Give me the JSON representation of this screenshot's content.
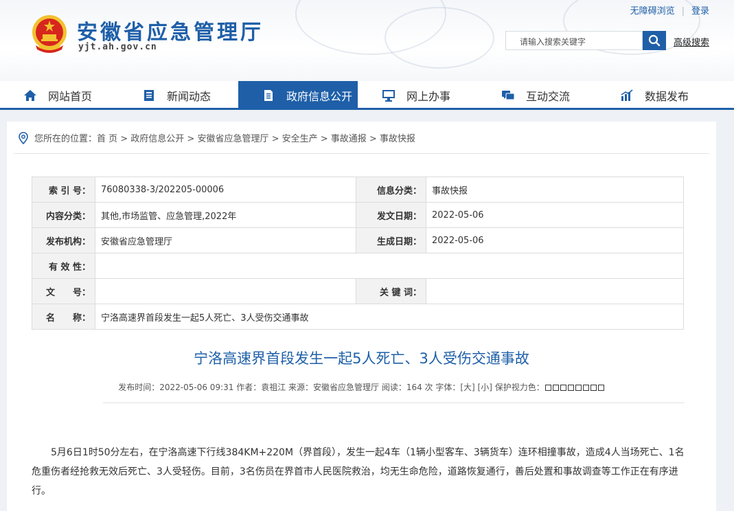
{
  "header": {
    "site_name": "安徽省应急管理厅",
    "domain": "yjt.ah.gov.cn",
    "accessibility_link": "无障碍浏览",
    "login_link": "登录",
    "search_placeholder": "请输入搜索关键字",
    "advanced_search": "高级搜索"
  },
  "nav": {
    "items": [
      {
        "label": "网站首页",
        "icon": "home-icon",
        "active": false
      },
      {
        "label": "新闻动态",
        "icon": "news-icon",
        "active": false
      },
      {
        "label": "政府信息公开",
        "icon": "document-icon",
        "active": true
      },
      {
        "label": "网上办事",
        "icon": "monitor-icon",
        "active": false
      },
      {
        "label": "互动交流",
        "icon": "chat-icon",
        "active": false
      },
      {
        "label": "数据发布",
        "icon": "chart-icon",
        "active": false
      }
    ]
  },
  "breadcrumb": {
    "text": "您所在的位置：首 页 > 政府信息公开 > 安徽省应急管理厅 > 安全生产 > 事故通报 > 事故快报"
  },
  "info": {
    "index_label": "索 引 号：",
    "index_value": "76080338-3/202205-00006",
    "category_label": "信息分类：",
    "category_value": "事故快报",
    "content_label": "内容分类：",
    "content_value": "其他,市场监管、应急管理,2022年",
    "pubdate_label": "发文日期：",
    "pubdate_value": "2022-05-06",
    "org_label": "发布机构：",
    "org_value": "安徽省应急管理厅",
    "gendate_label": "生成日期：",
    "gendate_value": "2022-05-06",
    "validity_label": "有 效 性：",
    "validity_value": "",
    "docno_label": "文　　号：",
    "docno_value": "",
    "keywords_label": "关 键 词：",
    "keywords_value": "",
    "name_label": "名　　称：",
    "name_value": "宁洛高速界首段发生一起5人死亡、3人受伤交通事故"
  },
  "article": {
    "title": "宁洛高速界首段发生一起5人死亡、3人受伤交通事故",
    "meta": "发布时间：2022-05-06 09:31   作者：袁祖江   来源：安徽省应急管理厅   阅读：164 次   字体：[大] [小]   保护视力色：",
    "body": "5月6日1时50分左右，在宁洛高速下行线384KM+220M（界首段），发生一起4车（1辆小型客车、3辆货车）连环相撞事故，造成4人当场死亡、1名危重伤者经抢救无效后死亡、3人受轻伤。目前，3名伤员在界首市人民医院救治，均无生命危险，道路恢复通行，善后处置和事故调查等工作正在有序进行。"
  },
  "colors": {
    "brand": "#1e5fa8",
    "emblem_red": "#d7261d",
    "emblem_gold": "#f2c230"
  }
}
